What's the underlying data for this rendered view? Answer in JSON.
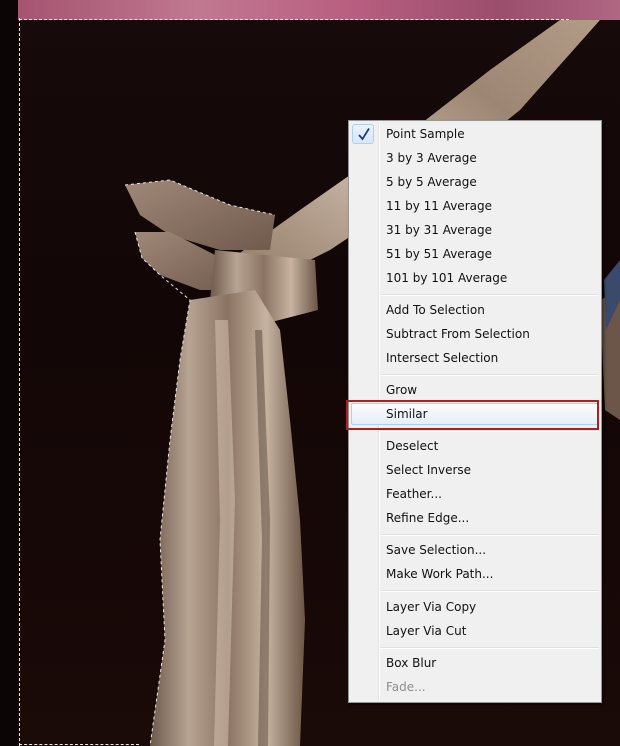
{
  "context_menu": {
    "items": [
      {
        "label": "Point Sample",
        "checked": true,
        "enabled": true
      },
      {
        "label": "3 by 3 Average",
        "enabled": true
      },
      {
        "label": "5 by 5 Average",
        "enabled": true
      },
      {
        "label": "11 by 11 Average",
        "enabled": true
      },
      {
        "label": "31 by 31 Average",
        "enabled": true
      },
      {
        "label": "51 by 51 Average",
        "enabled": true
      },
      {
        "label": "101 by 101 Average",
        "enabled": true
      },
      {
        "label": "Add To Selection",
        "enabled": true
      },
      {
        "label": "Subtract From Selection",
        "enabled": true
      },
      {
        "label": "Intersect Selection",
        "enabled": true
      },
      {
        "label": "Grow",
        "enabled": true
      },
      {
        "label": "Similar",
        "enabled": true,
        "highlighted": true
      },
      {
        "label": "Deselect",
        "enabled": true
      },
      {
        "label": "Select Inverse",
        "enabled": true
      },
      {
        "label": "Feather...",
        "enabled": true
      },
      {
        "label": "Refine Edge...",
        "enabled": true
      },
      {
        "label": "Save Selection...",
        "enabled": true
      },
      {
        "label": "Make Work Path...",
        "enabled": true
      },
      {
        "label": "Layer Via Copy",
        "enabled": true
      },
      {
        "label": "Layer Via Cut",
        "enabled": true
      },
      {
        "label": "Box Blur",
        "enabled": true
      },
      {
        "label": "Fade...",
        "enabled": false
      }
    ]
  },
  "icons": {
    "checkmark": "check-icon"
  },
  "colors": {
    "menu_background": "#f0f0f0",
    "highlight_border": "#aecff7",
    "annotation_border": "#b01e1e",
    "disabled_text": "#8d8d8d",
    "top_strip": "#b8688a",
    "canvas_background": "#120606"
  }
}
